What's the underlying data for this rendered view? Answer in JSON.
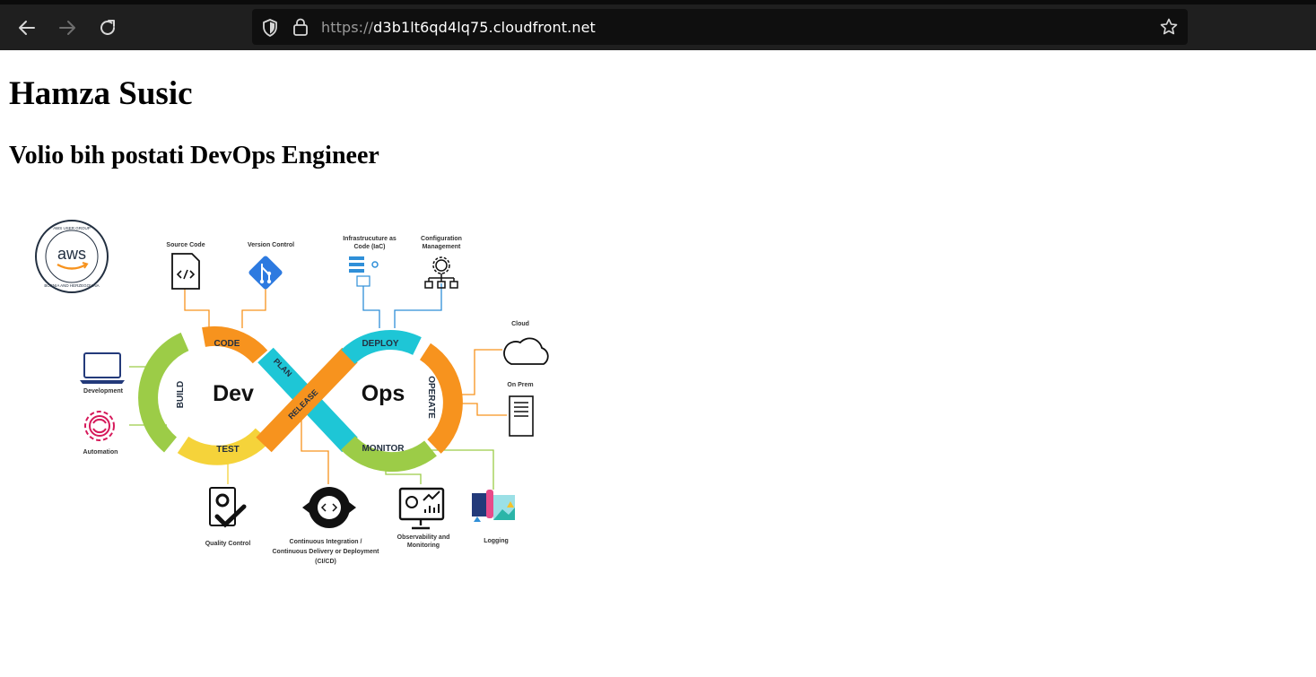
{
  "browser": {
    "url_scheme": "https://",
    "url_host": "d3b1lt6qd4lq75.cloudfront.net"
  },
  "page": {
    "title": "Hamza Susic",
    "subtitle": "Volio bih postati DevOps Engineer"
  },
  "diagram": {
    "badge": {
      "logo_text": "aws",
      "ring_top": "AWS USER GROUP",
      "ring_bottom": "BOSNIA AND HERZEGOVINA"
    },
    "center": {
      "dev": "Dev",
      "ops": "Ops"
    },
    "stages": {
      "code": "CODE",
      "build": "BUILD",
      "test": "TEST",
      "plan": "PLAN",
      "release": "RELEASE",
      "deploy": "DEPLOY",
      "operate": "OPERATE",
      "monitor": "MONITOR"
    },
    "labels": {
      "source_code": "Source Code",
      "version_control": "Version Control",
      "iac_line1": "Infrastrucuture as",
      "iac_line2": "Code (IaC)",
      "config_line1": "Configuration",
      "config_line2": "Management",
      "cloud": "Cloud",
      "on_prem": "On Prem",
      "development": "Development",
      "automation": "Automation",
      "quality_control": "Quality Control",
      "cicd_line1": "Continuous Integration /",
      "cicd_line2": "Continuous Delivery or Deployment",
      "cicd_line3": "(CI/CD)",
      "obs_line1": "Observability and",
      "obs_line2": "Monitoring",
      "logging": "Logging"
    },
    "colors": {
      "orange": "#f7931e",
      "teal": "#1ec6d6",
      "green": "#9ccc47",
      "yellow": "#f5d33a",
      "blue": "#2f8fd8",
      "git": "#2d7ae0",
      "navy": "#233a7a",
      "magenta": "#d6195a"
    }
  }
}
